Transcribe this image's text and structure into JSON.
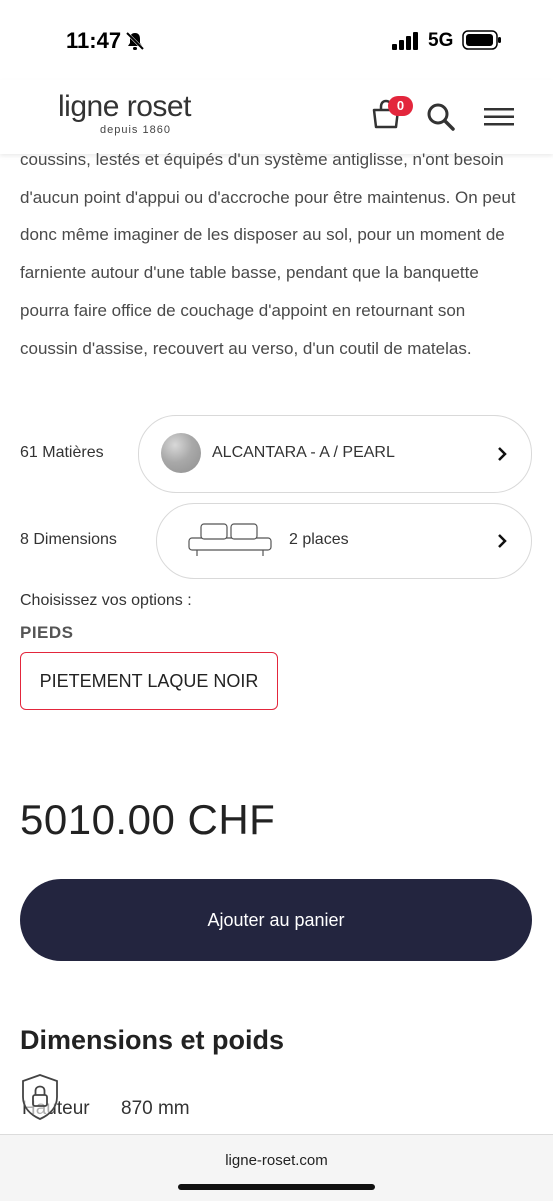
{
  "status": {
    "time": "11:47",
    "network": "5G"
  },
  "header": {
    "logo_main": "ligne roset",
    "logo_sub": "depuis 1860",
    "cart_count": "0"
  },
  "description": "coussins, lestés et équipés d'un système antiglisse, n'ont besoin d'aucun point d'appui ou d'accroche pour être maintenus. On peut donc même imaginer de les disposer au sol, pour un moment de farniente autour d'une table basse, pendant que la banquette pourra faire office de couchage d'appoint en retournant son coussin d'assise, recouvert au verso, d'un coutil de matelas.",
  "materials": {
    "label": "61 Matières",
    "value": "ALCANTARA - A / PEARL"
  },
  "dimensions": {
    "label": "8 Dimensions",
    "value": "2 places"
  },
  "options": {
    "prompt": "Choisissez vos options :",
    "group_label": "PIEDS",
    "selected": "PIETEMENT LAQUE NOIR"
  },
  "price": "5010.00 CHF",
  "add_to_cart": "Ajouter au panier",
  "specs": {
    "title": "Dimensions et poids",
    "rows": [
      {
        "label": "Hauteur",
        "value": "870 mm"
      }
    ]
  },
  "browser": {
    "url": "ligne-roset.com"
  },
  "colors": {
    "accent": "#e3263c",
    "button": "#23253f"
  }
}
